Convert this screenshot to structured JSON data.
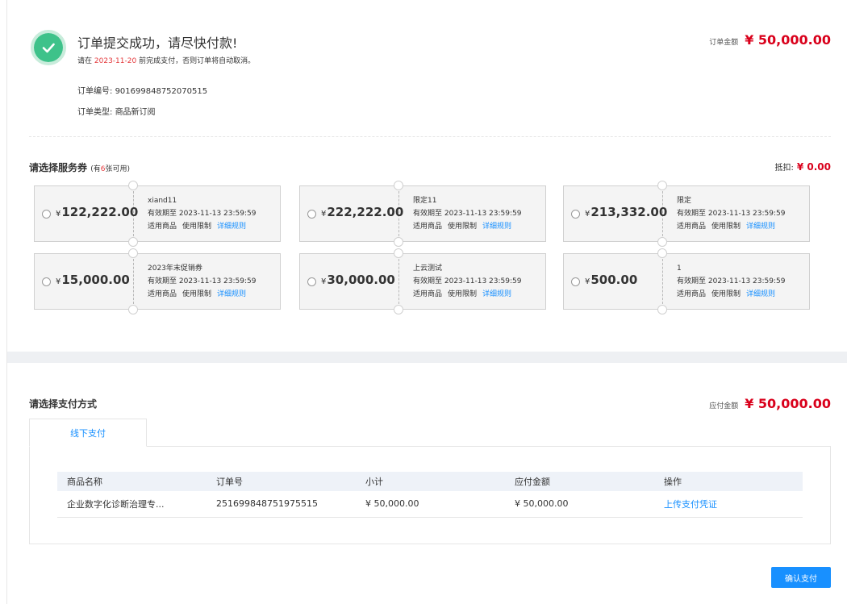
{
  "order": {
    "success_title": "订单提交成功，请尽快付款!",
    "deadline_prefix": "请在",
    "deadline_date": "2023-11-20",
    "deadline_suffix": "前完成支付，否则订单将自动取消。",
    "order_no_label": "订单编号:",
    "order_no": "901699848752070515",
    "order_type_label": "订单类型:",
    "order_type": "商品新订阅",
    "amount_label": "订单金额",
    "amount": "¥ 50,000.00",
    "success_color": "#3ec28a"
  },
  "coupons": {
    "title": "请选择服务券",
    "available_prefix": "(有",
    "available_count": "6",
    "available_suffix": "张可用)",
    "deduct_label": "抵扣:",
    "deduct_value": "¥ 0.00",
    "items": [
      {
        "currency": "¥",
        "price": "122,222.00",
        "name": "xiand11",
        "validity": "有效期至 2023-11-13 23:59:59",
        "link1": "适用商品",
        "link2": "使用限制",
        "link3": "详细规则"
      },
      {
        "currency": "¥",
        "price": "222,222.00",
        "name": "限定11",
        "validity": "有效期至 2023-11-13 23:59:59",
        "link1": "适用商品",
        "link2": "使用限制",
        "link3": "详细规则"
      },
      {
        "currency": "¥",
        "price": "213,332.00",
        "name": "限定",
        "validity": "有效期至 2023-11-13 23:59:59",
        "link1": "适用商品",
        "link2": "使用限制",
        "link3": "详细规则"
      },
      {
        "currency": "¥",
        "price": "15,000.00",
        "name": "2023年末促销券",
        "validity": "有效期至 2023-11-13 23:59:59",
        "link1": "适用商品",
        "link2": "使用限制",
        "link3": "详细规则"
      },
      {
        "currency": "¥",
        "price": "30,000.00",
        "name": "上云测试",
        "validity": "有效期至 2023-11-13 23:59:59",
        "link1": "适用商品",
        "link2": "使用限制",
        "link3": "详细规则"
      },
      {
        "currency": "¥",
        "price": "500.00",
        "name": "1",
        "validity": "有效期至 2023-11-13 23:59:59",
        "link1": "适用商品",
        "link2": "使用限制",
        "link3": "详细规则"
      }
    ]
  },
  "payment": {
    "title": "请选择支付方式",
    "amount_label": "应付金额",
    "amount": "¥ 50,000.00",
    "tab": "线下支付",
    "columns": [
      "商品名称",
      "订单号",
      "小计",
      "应付金额",
      "操作"
    ],
    "rows": [
      {
        "product": "企业数字化诊断治理专...",
        "order_no": "251699848751975515",
        "subtotal": "¥ 50,000.00",
        "payable": "¥ 50,000.00",
        "action": "上传支付凭证"
      }
    ],
    "confirm_label": "确认支付",
    "accent_color": "#1890ff",
    "price_color": "#d9001b"
  }
}
